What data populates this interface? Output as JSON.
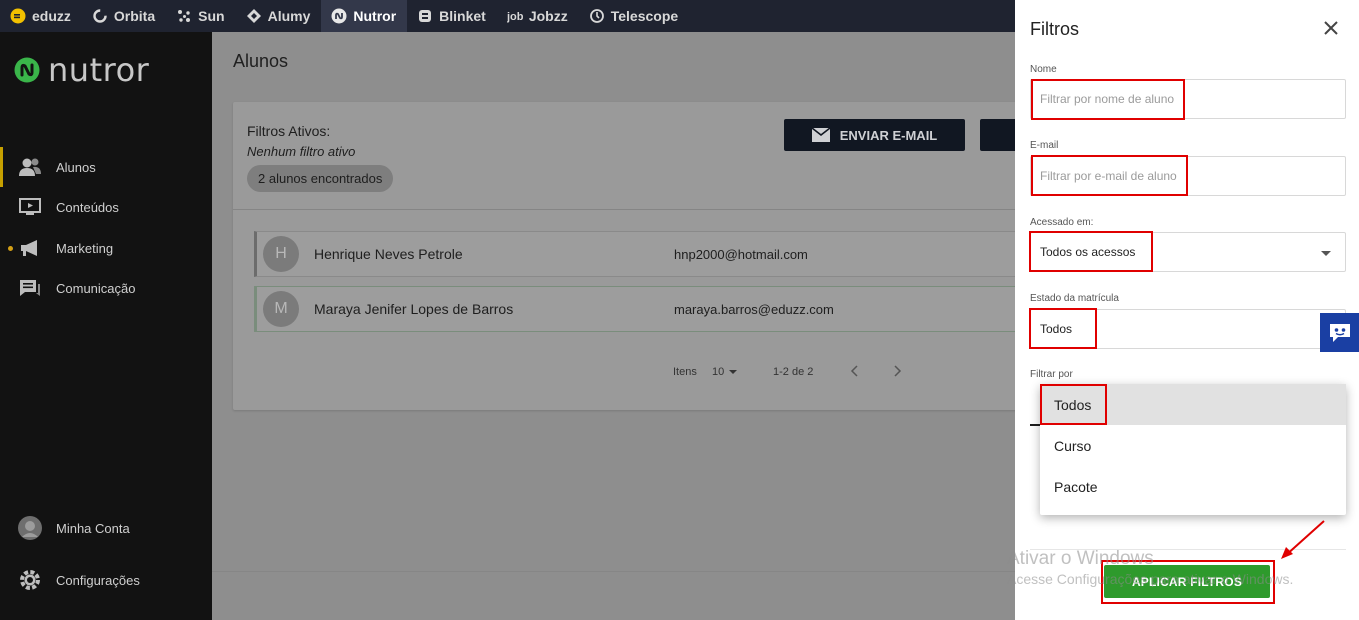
{
  "topbar": {
    "apps": [
      {
        "label": "eduzz",
        "icon": "eduzz-logo-icon"
      },
      {
        "label": "Orbita",
        "icon": "orbita-icon"
      },
      {
        "label": "Sun",
        "icon": "sun-icon"
      },
      {
        "label": "Alumy",
        "icon": "alumy-icon"
      },
      {
        "label": "Nutror",
        "icon": "nutror-icon",
        "active": true
      },
      {
        "label": "Blinket",
        "icon": "blinket-icon"
      },
      {
        "label": "Jobzz",
        "icon": "jobzz-icon"
      },
      {
        "label": "Telescope",
        "icon": "telescope-icon"
      }
    ]
  },
  "sidebar": {
    "logo_text": "nutror",
    "items": [
      {
        "label": "Alunos",
        "icon": "students-icon",
        "active": true
      },
      {
        "label": "Conteúdos",
        "icon": "content-icon"
      },
      {
        "label": "Marketing",
        "icon": "megaphone-icon",
        "notify": true
      },
      {
        "label": "Comunicação",
        "icon": "chat-icon"
      }
    ],
    "bottom": [
      {
        "label": "Minha Conta",
        "icon": "avatar-icon"
      },
      {
        "label": "Configurações",
        "icon": "gear-icon"
      }
    ]
  },
  "main": {
    "title": "Alunos",
    "filters_active_label": "Filtros Ativos:",
    "no_filter_text": "Nenhum filtro ativo",
    "results_chip": "2 alunos encontrados",
    "send_email_label": "ENVIAR E-MAIL",
    "students": [
      {
        "initial": "H",
        "name": "Henrique Neves Petrole",
        "email": "hnp2000@hotmail.com",
        "selected": false
      },
      {
        "initial": "M",
        "name": "Maraya Jenifer Lopes de Barros",
        "email": "maraya.barros@eduzz.com",
        "selected": true
      }
    ],
    "pagination": {
      "items_label": "Itens",
      "per_page": "10",
      "range": "1-2 de 2"
    }
  },
  "drawer": {
    "title": "Filtros",
    "name_label": "Nome",
    "name_placeholder": "Filtrar por nome de aluno",
    "email_label": "E-mail",
    "email_placeholder": "Filtrar por e-mail de aluno",
    "accessed_label": "Acessado em:",
    "accessed_value": "Todos os acessos",
    "status_label": "Estado da matrícula",
    "status_value": "Todos",
    "filter_by_label": "Filtrar por",
    "filter_by_options": [
      "Todos",
      "Curso",
      "Pacote"
    ],
    "apply_label": "APLICAR FILTROS"
  },
  "watermark": {
    "line1": "Ativar o Windows",
    "line2": "Acesse Configurações para ativar o Windows."
  },
  "colors": {
    "topbar": "#1f2330",
    "sidebar": "#121212",
    "apply_green": "#2e9a2c",
    "highlight_red": "#e00000",
    "chat_blue": "#1a3fa3"
  }
}
